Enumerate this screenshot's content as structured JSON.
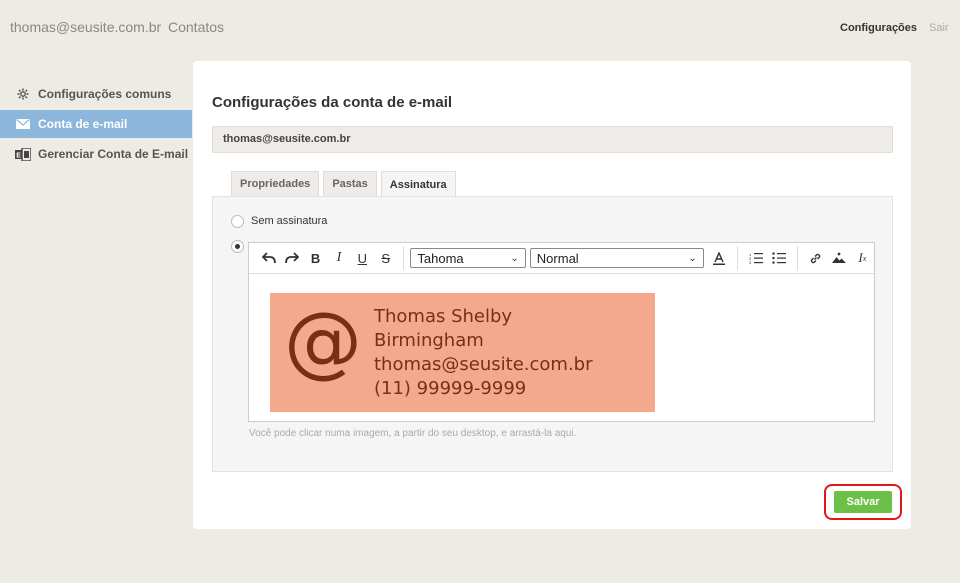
{
  "topbar": {
    "user_email": "thomas@seusite.com.br",
    "contacts": "Contatos",
    "settings": "Configurações",
    "logout": "Sair"
  },
  "sidebar": {
    "items": [
      {
        "label": "Configurações comuns",
        "icon": "gear-icon"
      },
      {
        "label": "Conta de e-mail",
        "icon": "envelope-icon"
      },
      {
        "label": "Gerenciar Conta de E-mail",
        "icon": "exchange-icon"
      }
    ]
  },
  "main": {
    "title": "Configurações da conta de e-mail",
    "account": "thomas@seusite.com.br",
    "tabs": [
      {
        "label": "Propriedades"
      },
      {
        "label": "Pastas"
      },
      {
        "label": "Assinatura"
      }
    ],
    "no_signature_label": "Sem assinatura",
    "editor": {
      "font": "Tahoma",
      "format": "Normal"
    },
    "signature": {
      "symbol": "@",
      "name": "Thomas Shelby",
      "city": "Birmingham",
      "email": "thomas@seusite.com.br",
      "phone": "(11) 99999-9999"
    },
    "hint": "Você pode clicar numa imagem, a partir do seu desktop, e arrastá-la aqui.",
    "save_label": "Salvar"
  },
  "colors": {
    "accent_sidebar": "#8db6dc",
    "signature_bg": "#f4a98d",
    "save_button": "#6cc04a",
    "highlight": "#e01818"
  }
}
